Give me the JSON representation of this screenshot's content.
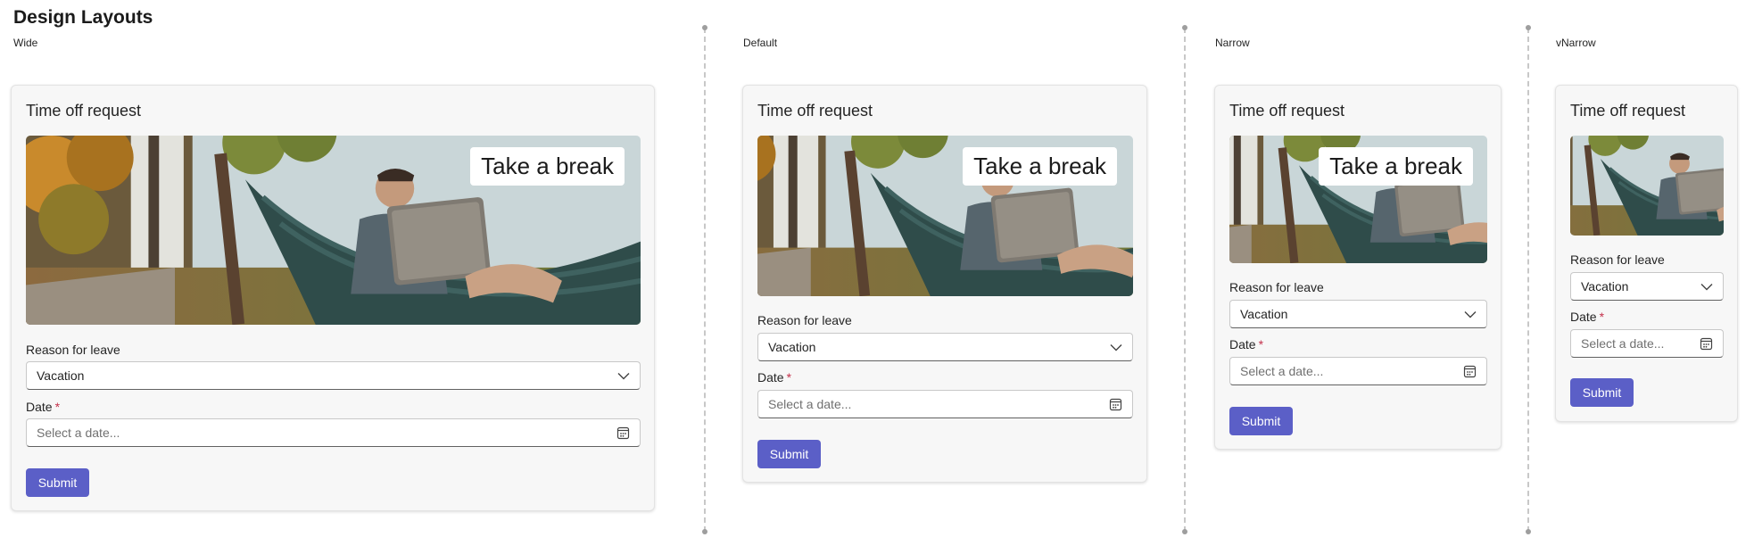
{
  "page": {
    "title": "Design Layouts"
  },
  "layouts": [
    {
      "label": "Wide"
    },
    {
      "label": "Default"
    },
    {
      "label": "Narrow"
    },
    {
      "label": "vNarrow"
    }
  ],
  "form": {
    "title": "Time off request",
    "image_caption": "Take a break",
    "reason_label": "Reason for leave",
    "reason_value": "Vacation",
    "date_label": "Date",
    "required_marker": "*",
    "date_placeholder": "Select a date...",
    "submit_label": "Submit"
  },
  "icons": {
    "dropdown": "chevron-down-icon",
    "date": "calendar-icon"
  },
  "colors": {
    "accent": "#5b5fc7",
    "required": "#c4314b",
    "card_background": "#f7f7f7"
  }
}
